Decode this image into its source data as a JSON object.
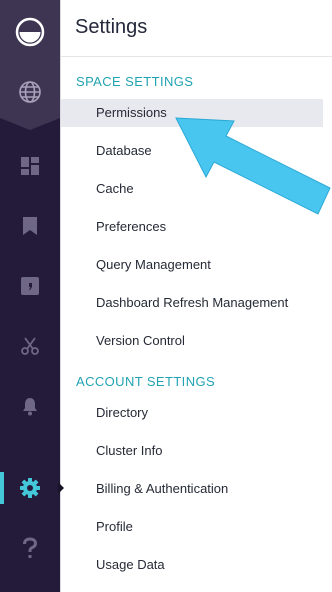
{
  "sidebar": {
    "icons": [
      "logo-icon",
      "globe-icon",
      "dashboard-icon",
      "bookmark-icon",
      "sql-editor-icon",
      "scissors-icon",
      "bell-icon",
      "gear-icon",
      "help-icon"
    ],
    "active_icon": "gear-icon",
    "colors": {
      "rail": "#241a3a",
      "rail_top": "#3e3552",
      "icon": "#6e6785",
      "active": "#44c7d8"
    }
  },
  "settings": {
    "title": "Settings",
    "space_header": "SPACE SETTINGS",
    "space_items": [
      "Permissions",
      "Database",
      "Cache",
      "Preferences",
      "Query Management",
      "Dashboard Refresh Management",
      "Version Control"
    ],
    "account_header": "ACCOUNT SETTINGS",
    "account_items": [
      "Directory",
      "Cluster Info",
      "Billing & Authentication",
      "Profile",
      "Usage Data"
    ],
    "selected_item": "Permissions",
    "colors": {
      "header": "#22a3b2",
      "selected_bg": "#e8e9ee"
    }
  },
  "annotation": {
    "arrow_color": "#49c6ef"
  }
}
